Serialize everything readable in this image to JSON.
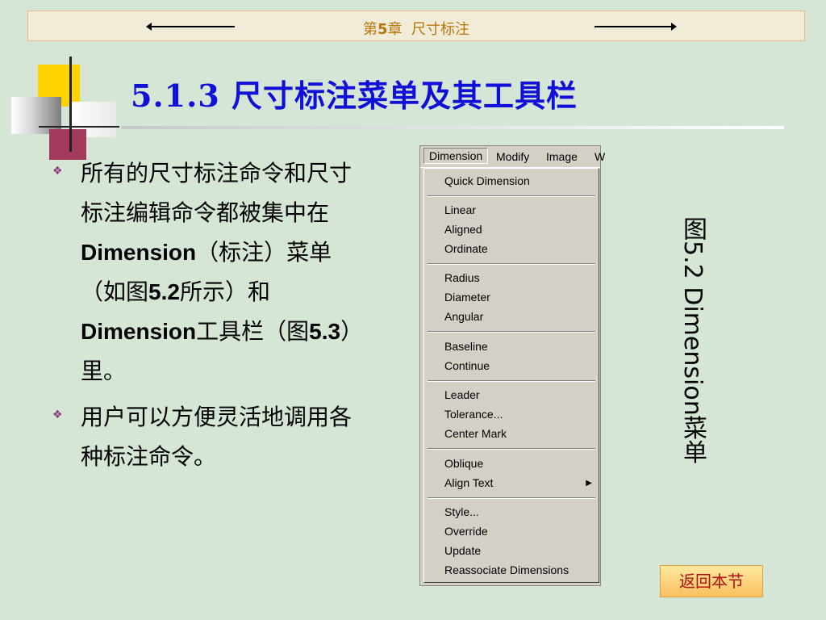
{
  "header": {
    "chapter_num": "5",
    "chapter_prefix": "第",
    "chapter_suffix": "章",
    "chapter_topic": "尺寸标注"
  },
  "page_title": "5.1.3  尺寸标注菜单及其工具栏",
  "bullets": [
    {
      "p1": "所有的尺寸标注命令和尺寸标注编辑命令都被集中在",
      "b1": "Dimension",
      "p2": "（标注）菜单（如图",
      "b2": "5.2",
      "p3": "所示）和",
      "b3": "Dimension",
      "p4": "工具栏（图",
      "b4": "5.3",
      "p5": "）里。"
    },
    {
      "text": "用户可以方便灵活地调用各种标注命令。"
    }
  ],
  "menu": {
    "bar": [
      "Dimension",
      "Modify",
      "Image",
      "W"
    ],
    "items": [
      "Quick Dimension",
      "Linear",
      "Aligned",
      "Ordinate",
      "Radius",
      "Diameter",
      "Angular",
      "Baseline",
      "Continue",
      "Leader",
      "Tolerance...",
      "Center Mark",
      "Oblique",
      "Align Text",
      "Style...",
      "Override",
      "Update",
      "Reassociate Dimensions"
    ]
  },
  "caption": "图5.2 Dimension菜单",
  "back_button": "返回本节"
}
